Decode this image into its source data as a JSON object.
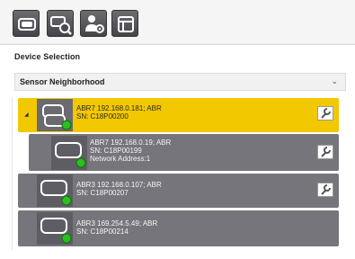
{
  "toolbar": {
    "buttons": [
      {
        "icon": "device-icon"
      },
      {
        "icon": "device-search-icon"
      },
      {
        "icon": "user-settings-icon"
      },
      {
        "icon": "window-layout-icon"
      }
    ]
  },
  "device_selection": {
    "title": "Device Selection",
    "dropdown": {
      "selected": "Sensor Neighborhood"
    }
  },
  "devices": [
    {
      "lines": [
        "ABR7 192.168.0.181; ABR",
        "SN: C18P00200"
      ],
      "selected": true,
      "status_color": "#2bbf1f"
    },
    {
      "lines": [
        "ABR7 192.168.0.19; ABR",
        "SN: C18P00199",
        "Network Address:1"
      ],
      "selected": false,
      "status_color": "#2bbf1f"
    },
    {
      "lines": [
        "ABR3 192.168.0.107; ABR",
        "SN: C18P00207"
      ],
      "selected": false,
      "status_color": "#2bbf1f"
    },
    {
      "lines": [
        "ABR3 169.254.5.49; ABR",
        "SN: C18P00214"
      ],
      "selected": false,
      "status_color": "#2bbf1f"
    }
  ],
  "colors": {
    "selected_row": "#f2c800",
    "device_row": "#76757b",
    "status_ok": "#2bbf1f"
  }
}
